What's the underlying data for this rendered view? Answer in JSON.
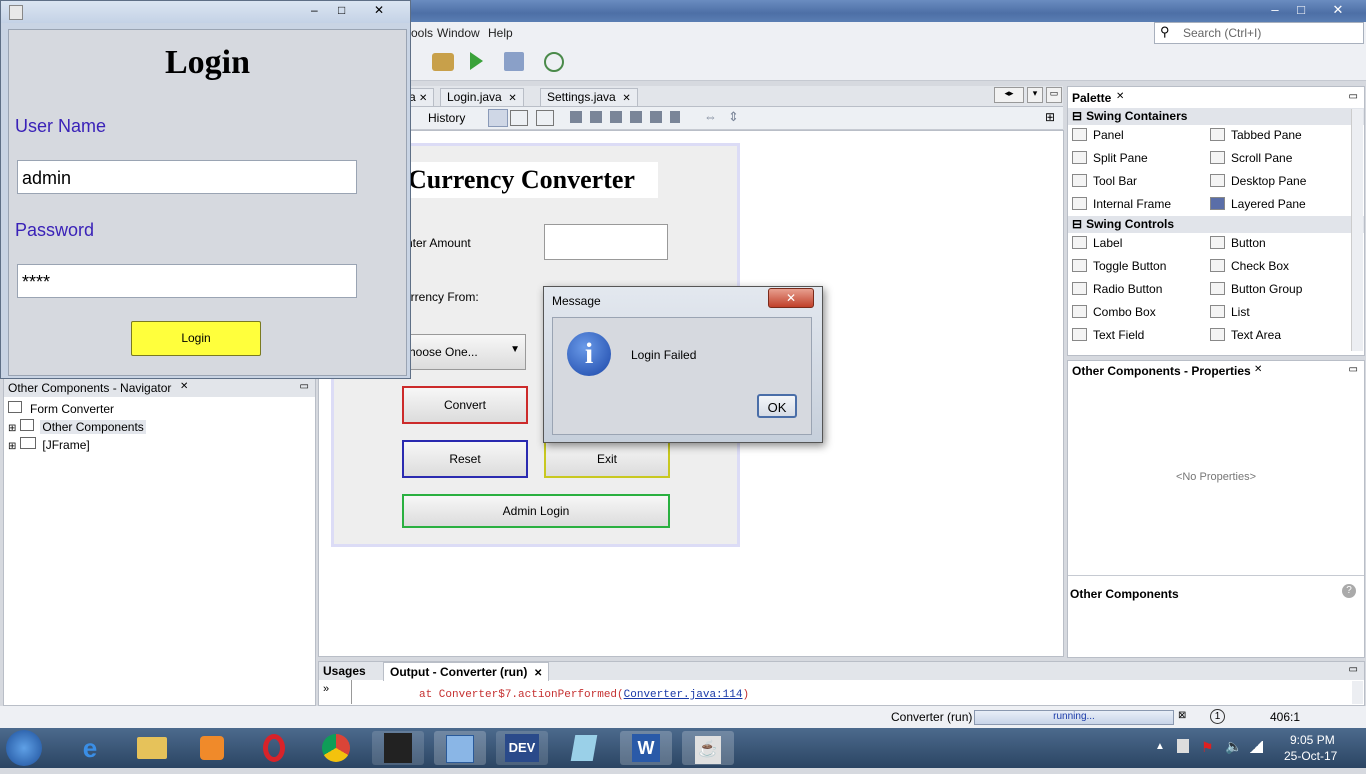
{
  "ide": {
    "menu": [
      "ools",
      "Window",
      "Help"
    ],
    "search_placeholder": "Search (Ctrl+I)",
    "editor_tabs": [
      "a",
      "Login.java",
      "Settings.java"
    ],
    "editor_toolbar": {
      "history": "History"
    },
    "window_controls": [
      "–",
      "□",
      "✕"
    ]
  },
  "designer": {
    "title": "Currency Converter",
    "enter_amount_label": "nter Amount",
    "currency_from_label": "urrency From:",
    "choose_one": "hoose One...",
    "convert_button": "Convert",
    "reset_button": "Reset",
    "exit_button": "Exit",
    "admin_login_button": "Admin Login"
  },
  "login": {
    "heading": "Login",
    "username_label": "User Name",
    "username_value": "admin",
    "password_label": "Password",
    "password_value": "****",
    "login_button": "Login",
    "controls": [
      "–",
      "□",
      "✕"
    ]
  },
  "message_dialog": {
    "title": "Message",
    "text": "Login Failed",
    "ok": "OK",
    "close": "✕"
  },
  "navigator": {
    "title": "Other Components - Navigator",
    "items": [
      "Form Converter",
      "Other Components",
      "[JFrame]"
    ]
  },
  "palette": {
    "title": "Palette",
    "section1": "Swing Containers",
    "containers": [
      "Panel",
      "Tabbed Pane",
      "Split Pane",
      "Scroll Pane",
      "Tool Bar",
      "Desktop Pane",
      "Internal Frame",
      "Layered Pane"
    ],
    "section2": "Swing Controls",
    "controls": [
      "Label",
      "Button",
      "Toggle Button",
      "Check Box",
      "Radio Button",
      "Button Group",
      "Combo Box",
      "List",
      "Text Field",
      "Text Area"
    ]
  },
  "properties": {
    "title": "Other Components - Properties",
    "empty": "<No Properties>",
    "footer": "Other Components"
  },
  "output": {
    "tab_usages": "Usages",
    "tab_output": "Output - Converter (run)",
    "line_prefix": "at Converter$7.actionPerformed(",
    "line_link": "Converter.java:114",
    "line_suffix": ")"
  },
  "status": {
    "task": "Converter (run)",
    "progress_text": "running...",
    "position": "406:1"
  },
  "taskbar": {
    "time": "9:05 PM",
    "date": "25-Oct-17",
    "dev_label": "DEV"
  },
  "colors": {
    "login_label": "#3a22b8",
    "login_button": "#ffff3c",
    "convert_border": "#cc2a2a",
    "reset_border": "#2a2ab0",
    "exit_border": "#c8c820",
    "admin_border": "#2ab040"
  }
}
